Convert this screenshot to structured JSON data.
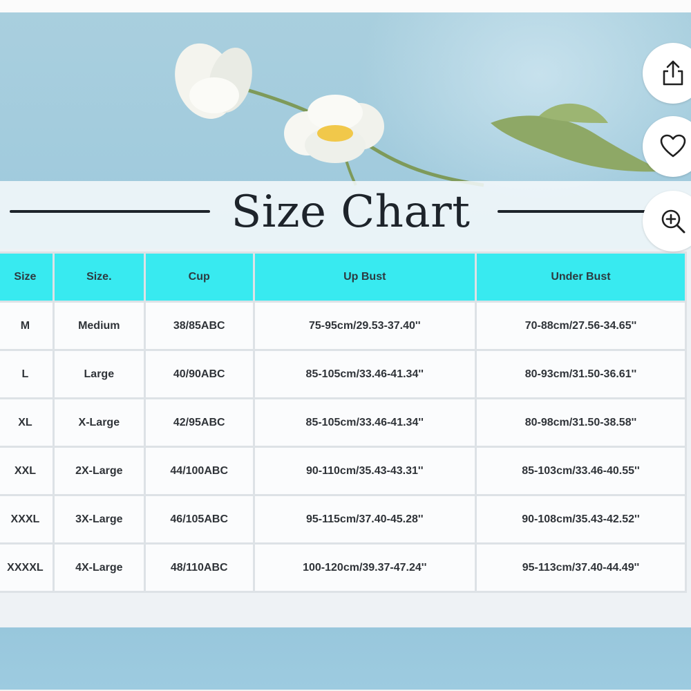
{
  "title": "Size Chart",
  "colors": {
    "header_bg": "#38eaf0",
    "background": "#9cc8dc",
    "title_text": "#1e242b"
  },
  "actions": [
    {
      "name": "share",
      "icon": "share-icon"
    },
    {
      "name": "favorite",
      "icon": "heart-icon"
    },
    {
      "name": "zoom",
      "icon": "zoom-in-icon"
    }
  ],
  "table": {
    "headers": [
      "Size",
      "Size.",
      "Cup",
      "Up Bust",
      "Under Bust"
    ],
    "rows": [
      [
        "M",
        "Medium",
        "38/85ABC",
        "75-95cm/29.53-37.40''",
        "70-88cm/27.56-34.65''"
      ],
      [
        "L",
        "Large",
        "40/90ABC",
        "85-105cm/33.46-41.34''",
        "80-93cm/31.50-36.61''"
      ],
      [
        "XL",
        "X-Large",
        "42/95ABC",
        "85-105cm/33.46-41.34''",
        "80-98cm/31.50-38.58''"
      ],
      [
        "XXL",
        "2X-Large",
        "44/100ABC",
        "90-110cm/35.43-43.31''",
        "85-103cm/33.46-40.55''"
      ],
      [
        "XXXL",
        "3X-Large",
        "46/105ABC",
        "95-115cm/37.40-45.28''",
        "90-108cm/35.43-42.52''"
      ],
      [
        "XXXXL",
        "4X-Large",
        "48/110ABC",
        "100-120cm/39.37-47.24''",
        "95-113cm/37.40-44.49''"
      ]
    ]
  }
}
